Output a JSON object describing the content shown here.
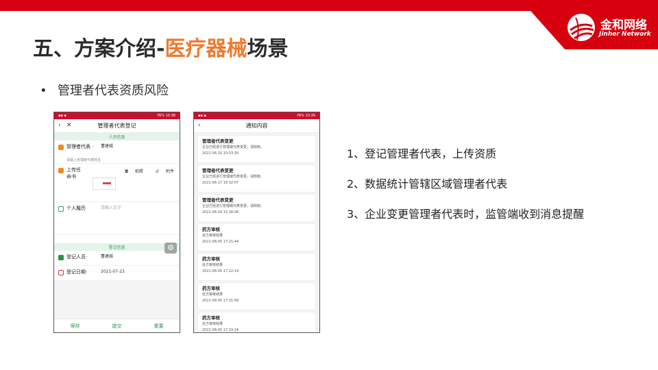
{
  "brand": {
    "name_cn": "金和网络",
    "name_en": "Jinher Network",
    "color": "#d7000f"
  },
  "slide": {
    "title_prefix": "五、方案介绍-",
    "title_highlight": "医疗器械",
    "title_suffix": "场景",
    "highlight_color": "#ee7a2e",
    "bullet_symbol": "•",
    "bullet_text": "管理者代表资质风险"
  },
  "phone_left": {
    "status_time": "10:38",
    "status_battery": "76%",
    "nav_title": "管理者代表登记",
    "section_person": "人员信息",
    "rep_label": "管理者代表",
    "rep_required": "·",
    "rep_value": "曹建威",
    "rep_hint": "请输入管理者代表姓名",
    "upload_label": "上传任命书",
    "photo_label": "拍照",
    "attach_label": "附件",
    "resume_label": "个人履历",
    "resume_placeholder": "请输入文字",
    "section_register": "登记信息",
    "registrant_label": "登记人员",
    "registrant_required": "·",
    "registrant_value": "曹建威",
    "date_label": "登记日期",
    "date_required": "·",
    "date_value": "2021-07-23",
    "btn_save": "保存",
    "btn_submit": "提交",
    "btn_reset": "重置"
  },
  "phone_right": {
    "status_time": "10:39",
    "status_battery": "76%",
    "nav_title": "通知内容",
    "notices": [
      {
        "title": "管理者代表变更",
        "desc": "企业已经进行管理或代表变更，请知晓。",
        "time": "2021-06-10 10:53:30"
      },
      {
        "title": "管理者代表变更",
        "desc": "企业已经进行管理或代表变更，请知晓。",
        "time": "2021-06-17 16:32:07"
      },
      {
        "title": "管理者代表变更",
        "desc": "企业已经进行管理或代表变更，请知晓。",
        "time": "2021-06-29 15:38:06"
      },
      {
        "title": "药方审核",
        "desc": "处方审核结果",
        "time": "2021-08-05 17:21:44"
      },
      {
        "title": "药方审核",
        "desc": "处方审核结果",
        "time": "2021-08-05 17:22:19"
      },
      {
        "title": "药方审核",
        "desc": "处方审核结果",
        "time": "2021-08-05 17:31:58"
      },
      {
        "title": "药方审核",
        "desc": "处方审核结果",
        "time": "2021-08-05 17:33:24"
      }
    ]
  },
  "points": [
    "1、登记管理者代表，上传资质",
    "2、数据统计管辖区域管理者代表",
    "3、企业变更管理者代表时，监管端收到消息提醒"
  ]
}
